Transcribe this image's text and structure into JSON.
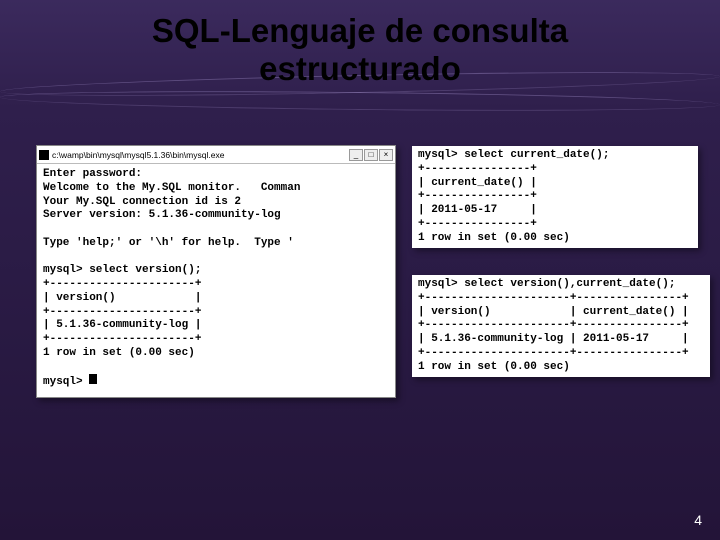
{
  "title_line1": "SQL-Lenguaje de consulta",
  "title_line2": "estructurado",
  "slide_number": "4",
  "window": {
    "path": "c:\\wamp\\bin\\mysql\\mysql5.1.36\\bin\\mysql.exe",
    "min": "_",
    "max": "□",
    "close": "×",
    "lines": [
      "Enter password:",
      "Welcome to the My.SQL monitor.   Comman",
      "Your My.SQL connection id is 2",
      "Server version: 5.1.36-community-log",
      "",
      "Type 'help;' or '\\h' for help.  Type '",
      "",
      "mysql> select version();",
      "+----------------------+",
      "| version()            |",
      "+----------------------+",
      "| 5.1.36-community-log |",
      "+----------------------+",
      "1 row in set (0.00 sec)",
      "",
      "mysql> "
    ]
  },
  "snippet_a": [
    "mysql> select current_date();",
    "+----------------+",
    "| current_date() |",
    "+----------------+",
    "| 2011-05-17     |",
    "+----------------+",
    "1 row in set (0.00 sec)"
  ],
  "snippet_b": [
    "mysql> select version(),current_date();",
    "+----------------------+----------------+",
    "| version()            | current_date() |",
    "+----------------------+----------------+",
    "| 5.1.36-community-log | 2011-05-17     |",
    "+----------------------+----------------+",
    "1 row in set (0.00 sec)"
  ]
}
